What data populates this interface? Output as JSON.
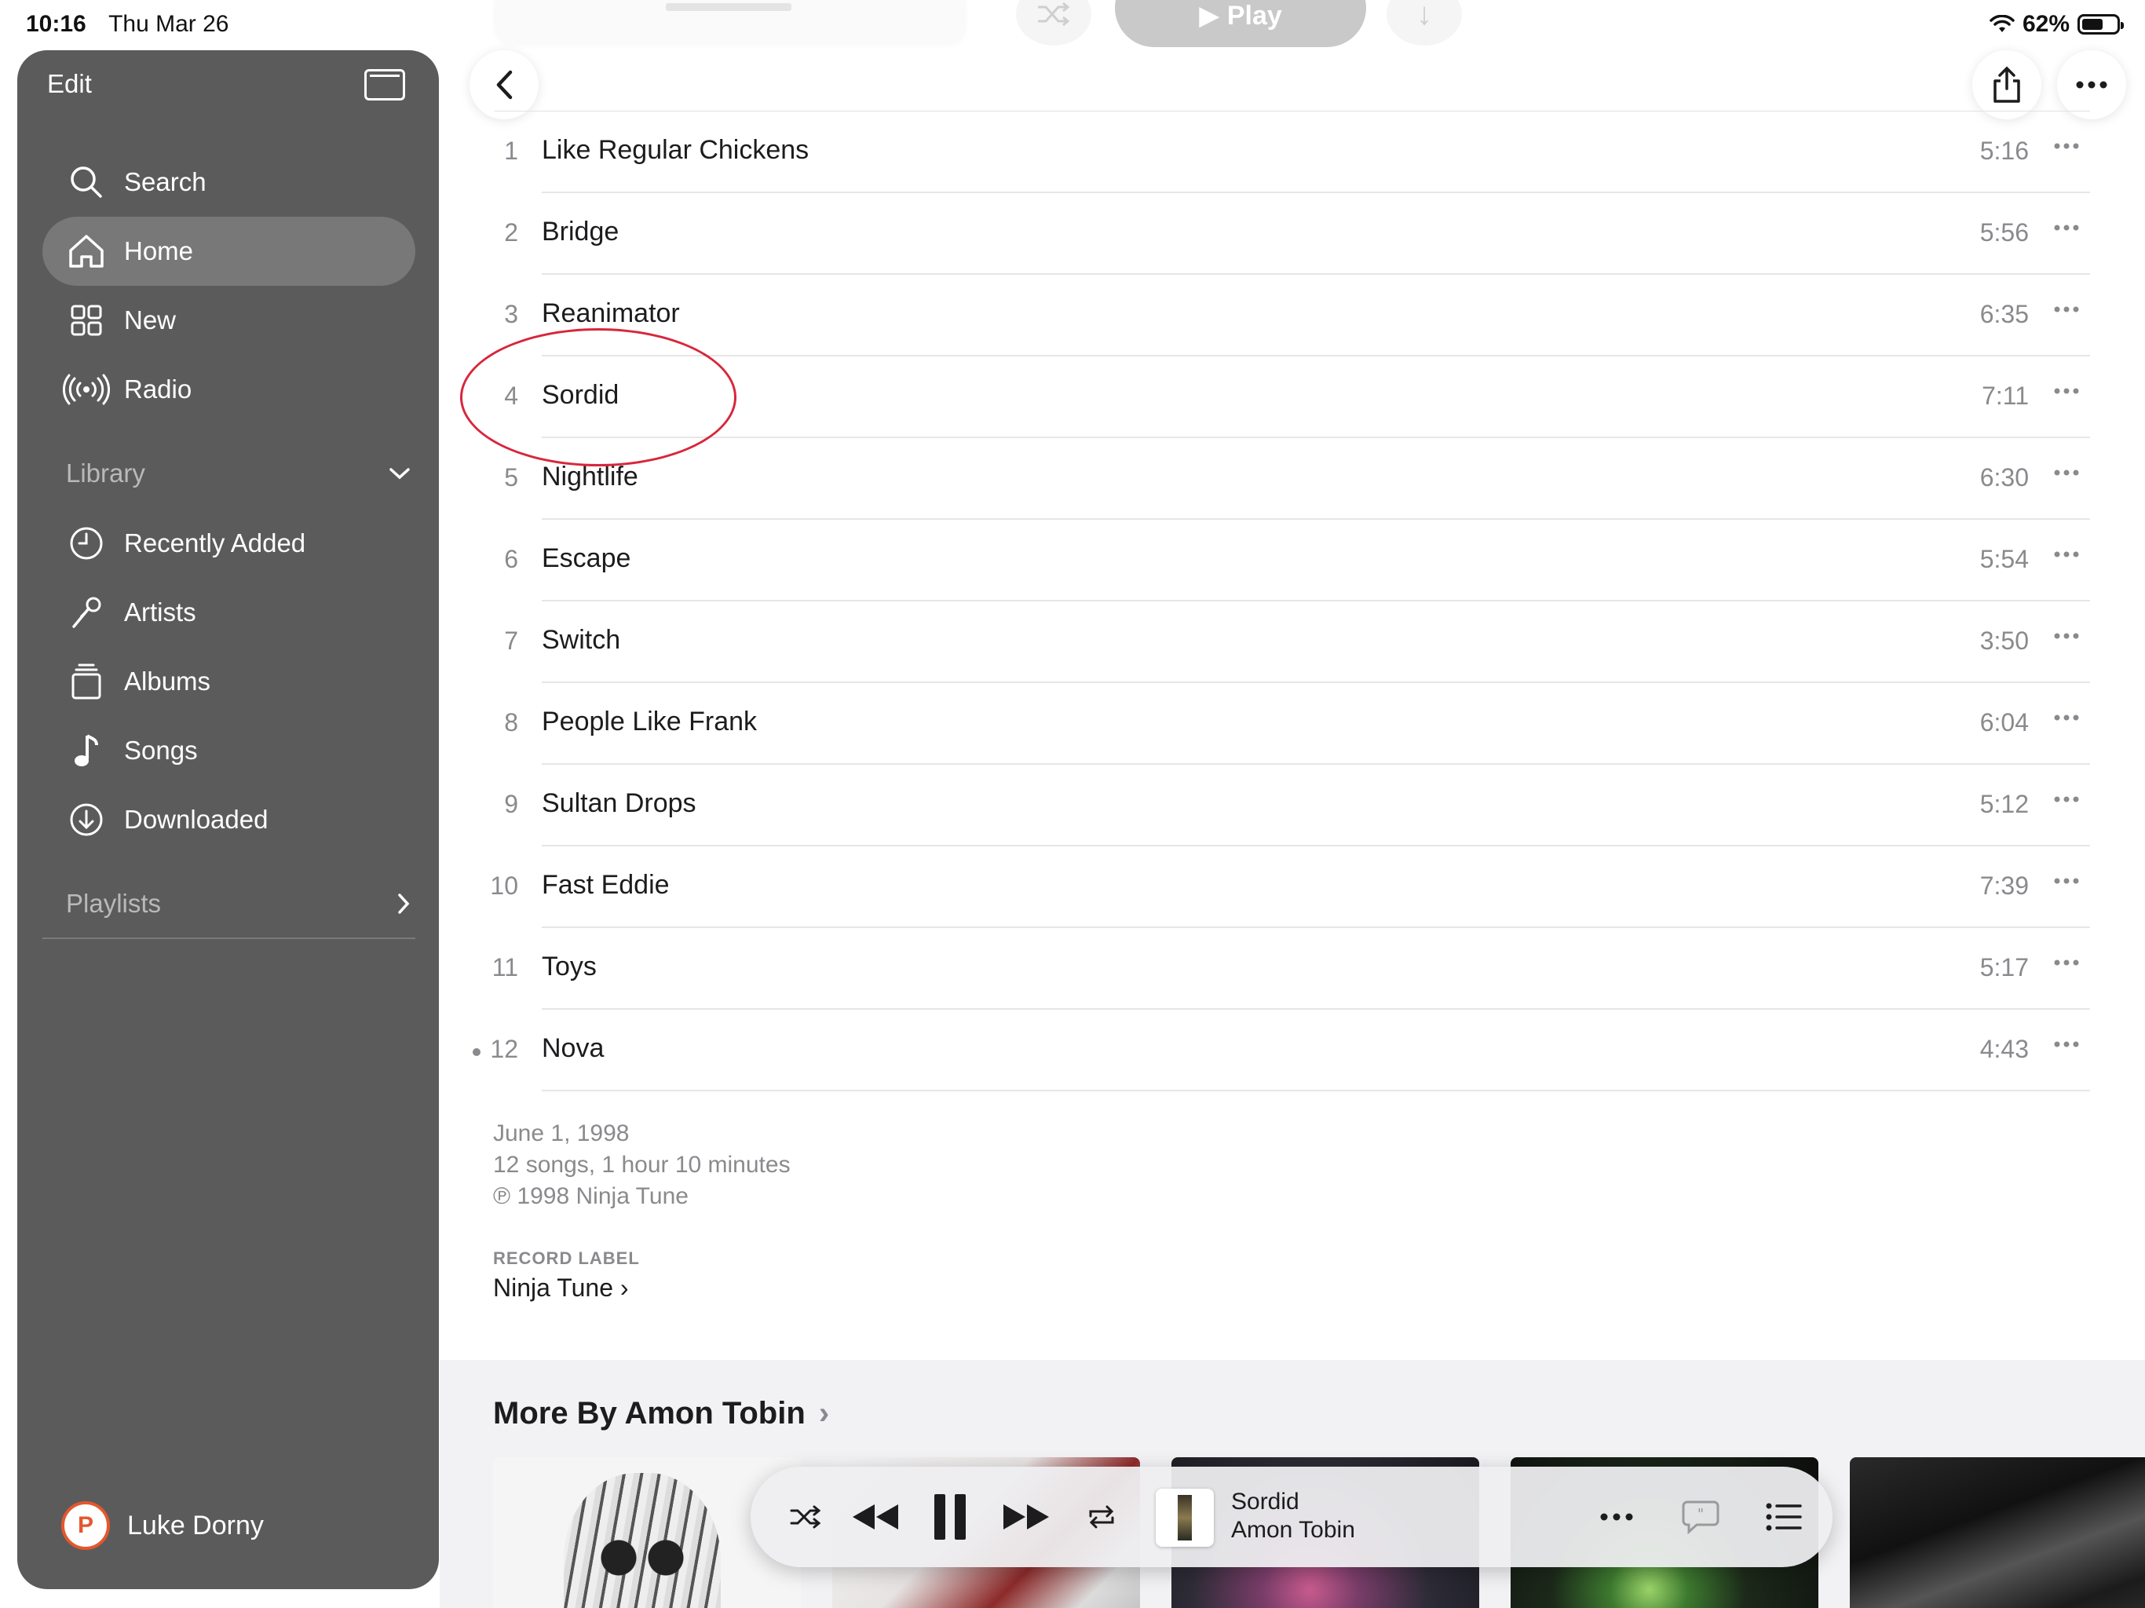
{
  "status_bar": {
    "time": "10:16",
    "date": "Thu Mar 26",
    "battery": "62%",
    "battery_level": 0.62
  },
  "header": {
    "play_label": "Play"
  },
  "sidebar": {
    "edit_label": "Edit",
    "nav": [
      {
        "label": "Search",
        "icon": "search-icon",
        "active": false
      },
      {
        "label": "Home",
        "icon": "home-icon",
        "active": true
      },
      {
        "label": "New",
        "icon": "grid-icon",
        "active": false
      },
      {
        "label": "Radio",
        "icon": "radio-icon",
        "active": false
      }
    ],
    "library_label": "Library",
    "library": [
      {
        "label": "Recently Added",
        "icon": "clock-icon"
      },
      {
        "label": "Artists",
        "icon": "microphone-icon"
      },
      {
        "label": "Albums",
        "icon": "album-stack-icon"
      },
      {
        "label": "Songs",
        "icon": "music-note-icon"
      },
      {
        "label": "Downloaded",
        "icon": "download-circle-icon"
      }
    ],
    "playlists_label": "Playlists",
    "user_name": "Luke Dorny"
  },
  "tracks": [
    {
      "num": "1",
      "title": "Like Regular Chickens",
      "duration": "5:16"
    },
    {
      "num": "2",
      "title": "Bridge",
      "duration": "5:56"
    },
    {
      "num": "3",
      "title": "Reanimator",
      "duration": "6:35"
    },
    {
      "num": "4",
      "title": "Sordid",
      "duration": "7:11"
    },
    {
      "num": "5",
      "title": "Nightlife",
      "duration": "6:30"
    },
    {
      "num": "6",
      "title": "Escape",
      "duration": "5:54"
    },
    {
      "num": "7",
      "title": "Switch",
      "duration": "3:50"
    },
    {
      "num": "8",
      "title": "People Like Frank",
      "duration": "6:04"
    },
    {
      "num": "9",
      "title": "Sultan Drops",
      "duration": "5:12"
    },
    {
      "num": "10",
      "title": "Fast Eddie",
      "duration": "7:39"
    },
    {
      "num": "11",
      "title": "Toys",
      "duration": "5:17"
    },
    {
      "num": "12",
      "title": "Nova",
      "duration": "4:43"
    }
  ],
  "album_info": {
    "release_date": "June 1, 1998",
    "summary": "12 songs, 1 hour 10 minutes",
    "copyright": "℗ 1998 Ninja Tune",
    "record_label_heading": "RECORD LABEL",
    "record_label": "Ninja Tune"
  },
  "more_by": {
    "title": "More By Amon Tobin"
  },
  "now_playing": {
    "title": "Sordid",
    "artist": "Amon Tobin"
  },
  "colors": {
    "sidebar_bg": "#5b5b5b",
    "sidebar_active": "#787878",
    "annotation_circle": "#d8263b",
    "secondary_text": "#8a8a8e"
  }
}
